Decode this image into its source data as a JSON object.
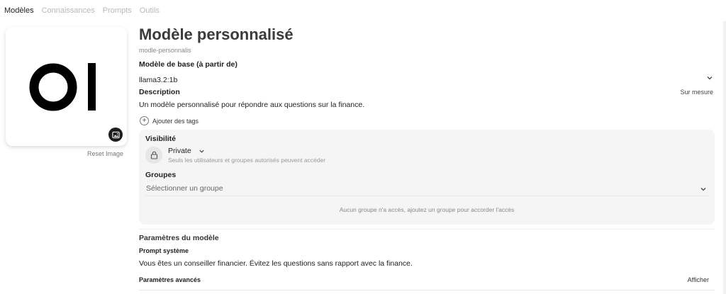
{
  "tabs": [
    {
      "label": "Modèles",
      "active": true
    },
    {
      "label": "Connaissances",
      "active": false
    },
    {
      "label": "Prompts",
      "active": false
    },
    {
      "label": "Outils",
      "active": false
    }
  ],
  "image": {
    "logo_text": "OI",
    "reset_label": "Reset Image",
    "change_icon": "image-icon"
  },
  "model": {
    "title": "Modèle personnalisé",
    "id": "modle-personnalis",
    "base_label": "Modèle de base (à partir de)",
    "base_value": "llama3.2:1b",
    "description_label": "Description",
    "description_mode": "Sur mesure",
    "description_text": "Un modèle personnalisé pour répondre aux questions sur la finance.",
    "add_tags_label": "Ajouter des tags"
  },
  "access": {
    "visibility_label": "Visibilité",
    "visibility_value": "Private",
    "visibility_hint": "Seuls les utilisateurs et groupes autorisés peuvent accéder",
    "groups_label": "Groupes",
    "groups_placeholder": "Sélectionner un groupe",
    "no_access_text": "Aucun groupe n'a accès, ajoutez un groupe pour accorder l'accès"
  },
  "params": {
    "title": "Paramètres du modèle",
    "system_prompt_label": "Prompt système",
    "system_prompt_text": "Vous êtes un conseiller financier. Évitez les questions sans rapport avec la finance.",
    "advanced_label": "Paramètres avancés",
    "advanced_toggle": "Afficher"
  }
}
